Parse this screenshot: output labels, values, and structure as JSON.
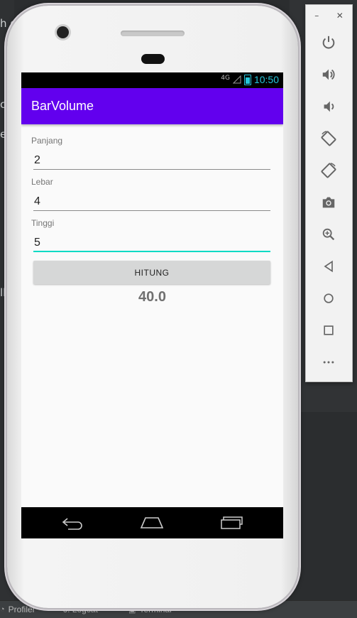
{
  "ide": {
    "left_fragments": [
      "h d",
      "c",
      "eh",
      "lh"
    ],
    "bottom_tabs": [
      {
        "label": "Profiler"
      },
      {
        "label": "6: Logcat"
      },
      {
        "label": "Terminal"
      }
    ]
  },
  "device": {
    "status_bar": {
      "network": "4G",
      "time": "10:50"
    },
    "app_bar": {
      "title": "BarVolume"
    },
    "form": {
      "fields": [
        {
          "label": "Panjang",
          "value": "2"
        },
        {
          "label": "Lebar",
          "value": "4"
        },
        {
          "label": "Tinggi",
          "value": "5"
        }
      ],
      "button_label": "HITUNG",
      "result": "40.0"
    }
  },
  "emulator_toolbar": {
    "controls": [
      "minimize",
      "close"
    ],
    "buttons": [
      "power-icon",
      "volume-up-icon",
      "volume-down-icon",
      "rotate-left-icon",
      "rotate-right-icon",
      "camera-icon",
      "zoom-icon",
      "back-icon",
      "home-icon",
      "overview-icon",
      "more-icon"
    ]
  },
  "colors": {
    "primary": "#6200ee",
    "accent": "#03dac5",
    "status_time": "#26c6da"
  }
}
